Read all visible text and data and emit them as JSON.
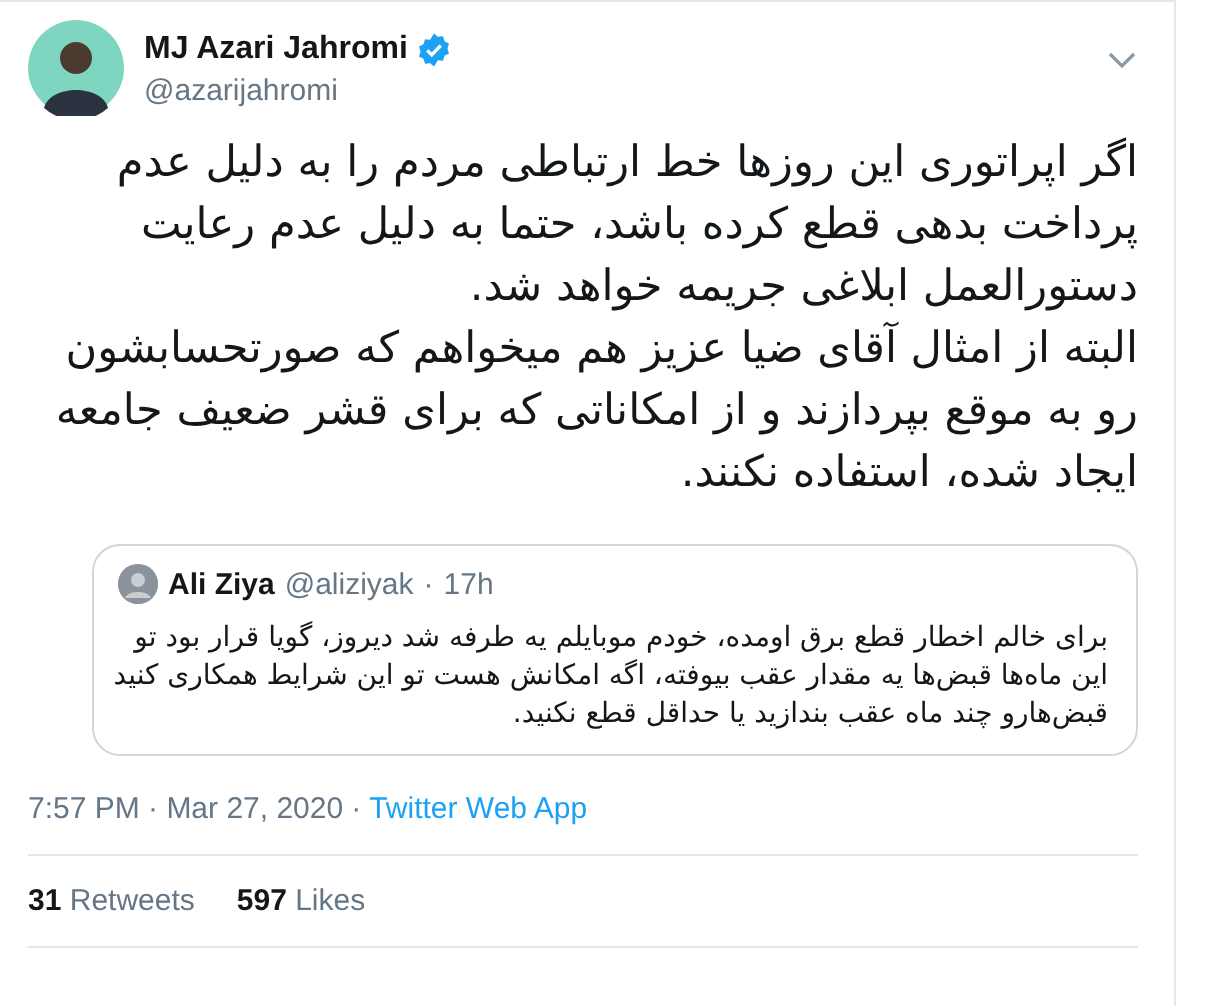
{
  "tweet": {
    "author": {
      "name": "MJ Azari Jahromi",
      "verified": true,
      "handle": "@azarijahromi"
    },
    "paragraphs": [
      "اگر اپراتوری این روزها خط ارتباطی مردم را به دلیل عدم پرداخت بدهی قطع کرده باشد، حتما به دلیل عدم رعایت دستورالعمل ابلاغی جریمه خواهد شد.",
      "البته از امثال آقای ضیا عزیز هم میخواهم که صورتحسابشون رو به موقع بپردازند و از امکاناتی که برای قشر ضعیف جامعه ایجاد شده، استفاده نکنند."
    ],
    "quoted": {
      "name": "Ali Ziya",
      "handle": "@aliziyak",
      "separator": "·",
      "time": "17h",
      "text": "برای خالم اخطار قطع برق اومده، خودم موبایلم یه طرفه شد دیروز، گویا قرار بود تو این ماه‌ها قبض‌ها یه مقدار عقب بیوفته، اگه امکانش هست تو این شرایط همکاری کنید قبض‌هارو چند ماه عقب بندازید یا حداقل قطع نکنید."
    },
    "time": "7:57 PM · Mar 27, 2020",
    "separator": "·",
    "source": "Twitter Web App",
    "retweets": "**31** Retweets",
    "likes": "**597** Likes"
  }
}
